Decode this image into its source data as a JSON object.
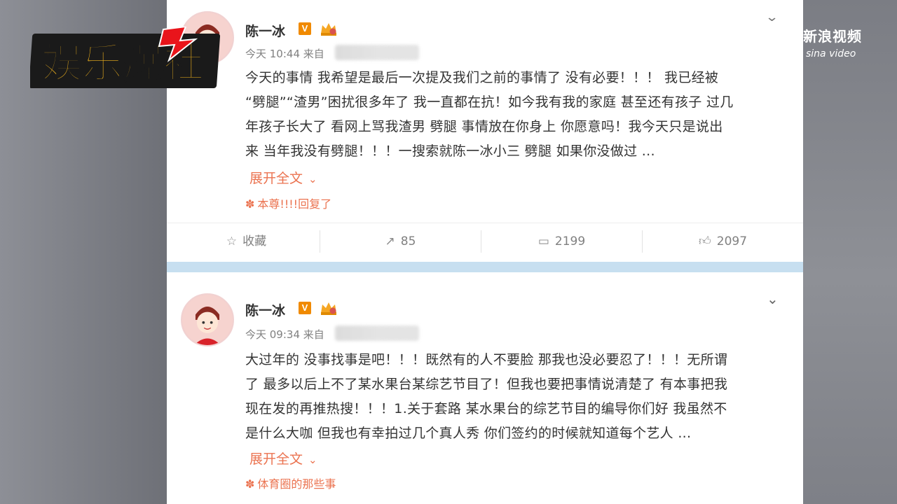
{
  "branding": {
    "logo_text": "娱乐爆社",
    "watermark_cn": "新浪视频",
    "watermark_en": "sina video"
  },
  "posts": [
    {
      "username": "陈一冰",
      "verified_badge": "V",
      "time": "今天 10:44",
      "from_label": "来自",
      "lines": [
        "今天的事情 我希望是最后一次提及我们之前的事情了 没有必要！！！ 我已经被",
        "“劈腿”“渣男”困扰很多年了 我一直都在抗！如今我有我的家庭 甚至还有孩子 过几",
        "年孩子长大了 看网上骂我渣男 劈腿 事情放在你身上 你愿意吗！我今天只是说出",
        "来 当年我没有劈腿！！！一搜索就陈一冰小三 劈腿 如果你没做过 ..."
      ],
      "expand_label": "展开全文",
      "source_label": "本尊!!!!回复了",
      "toolbar": {
        "favorite_label": "收藏",
        "repost_count": "85",
        "comment_count": "2199",
        "like_count": "2097"
      }
    },
    {
      "username": "陈一冰",
      "verified_badge": "V",
      "time": "今天 09:34",
      "from_label": "来自",
      "lines": [
        "大过年的 没事找事是吧！！！既然有的人不要脸 那我也没必要忍了！！！无所谓",
        "了 最多以后上不了某水果台某综艺节目了！但我也要把事情说清楚了 有本事把我",
        "现在发的再推热搜！！！1.关于套路 某水果台的综艺节目的编导你们好 我虽然不",
        "是什么大咖 但我也有幸拍过几个真人秀 你们签约的时候就知道每个艺人 ..."
      ],
      "expand_label": "展开全文",
      "source_label": "体育圈的那些事"
    }
  ],
  "colors": {
    "accent": "#eb7350",
    "verified": "#f08a00",
    "divider": "#c7dff0"
  },
  "icons": [
    "star-icon",
    "repost-icon",
    "comment-icon",
    "thumbs-up-icon",
    "chevron-down-icon",
    "flower-icon",
    "crown-icon"
  ]
}
